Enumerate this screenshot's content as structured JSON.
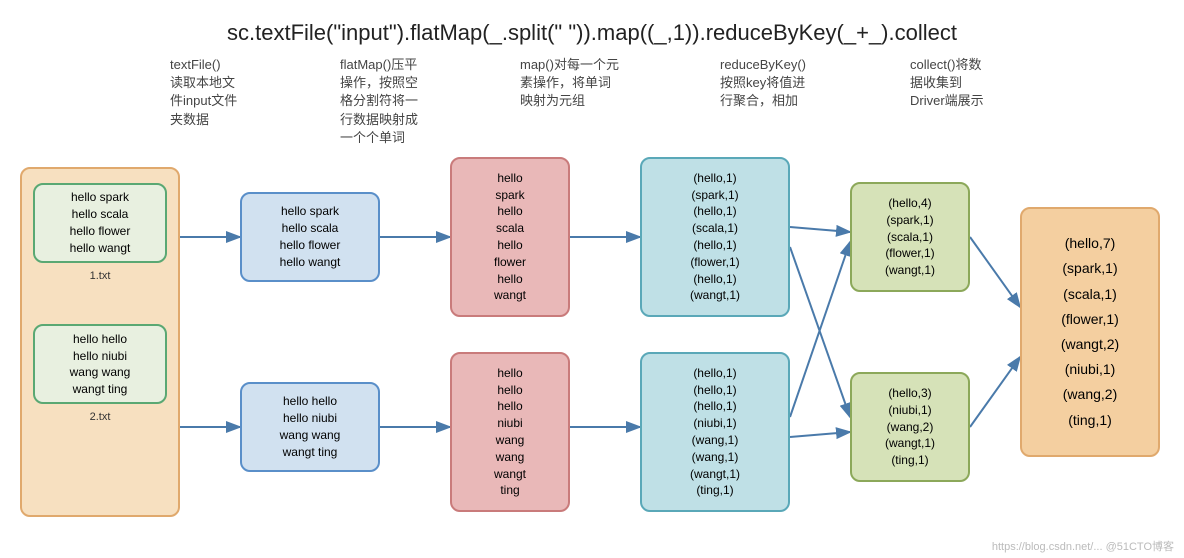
{
  "title": "sc.textFile(\"input\").flatMap(_.split(\" \")).map((_,1)).reduceByKey(_+_).collect",
  "stages": {
    "textFile": "textFile()\n读取本地文\n件input文件\n夹数据",
    "flatMap": "flatMap()压平\n操作，按照空\n格分割符将一\n行数据映射成\n一个个单词",
    "map": "map()对每一个元\n素操作，将单词\n映射为元组",
    "reduceByKey": "reduceByKey()\n按照key将值进\n行聚合，相加",
    "collect": "collect()将数\n据收集到\nDriver端展示"
  },
  "input": {
    "file1": {
      "name": "1.txt",
      "lines": [
        "hello spark",
        "hello scala",
        "hello flower",
        "hello wangt"
      ]
    },
    "file2": {
      "name": "2.txt",
      "lines": [
        "hello hello",
        "hello niubi",
        "wang wang",
        "wangt ting"
      ]
    }
  },
  "textFileOut": {
    "p1": [
      "hello spark",
      "hello scala",
      "hello flower",
      "hello wangt"
    ],
    "p2": [
      "hello hello",
      "hello niubi",
      "wang wang",
      "wangt ting"
    ]
  },
  "flatMapOut": {
    "p1": [
      "hello",
      "spark",
      "hello",
      "scala",
      "hello",
      "flower",
      "hello",
      "wangt"
    ],
    "p2": [
      "hello",
      "hello",
      "hello",
      "niubi",
      "wang",
      "wang",
      "wangt",
      "ting"
    ]
  },
  "mapOut": {
    "p1": [
      "(hello,1)",
      "(spark,1)",
      "(hello,1)",
      "(scala,1)",
      "(hello,1)",
      "(flower,1)",
      "(hello,1)",
      "(wangt,1)"
    ],
    "p2": [
      "(hello,1)",
      "(hello,1)",
      "(hello,1)",
      "(niubi,1)",
      "(wang,1)",
      "(wang,1)",
      "(wangt,1)",
      "(ting,1)"
    ]
  },
  "reduceOut": {
    "p1": [
      "(hello,4)",
      "(spark,1)",
      "(scala,1)",
      "(flower,1)",
      "(wangt,1)"
    ],
    "p2": [
      "(hello,3)",
      "(niubi,1)",
      "(wang,2)",
      "(wangt,1)",
      "(ting,1)"
    ]
  },
  "collectOut": [
    "(hello,7)",
    "(spark,1)",
    "(scala,1)",
    "(flower,1)",
    "(wangt,2)",
    "(niubi,1)",
    "(wang,2)",
    "(ting,1)"
  ],
  "watermark": "https://blog.csdn.net/... @51CTO博客"
}
